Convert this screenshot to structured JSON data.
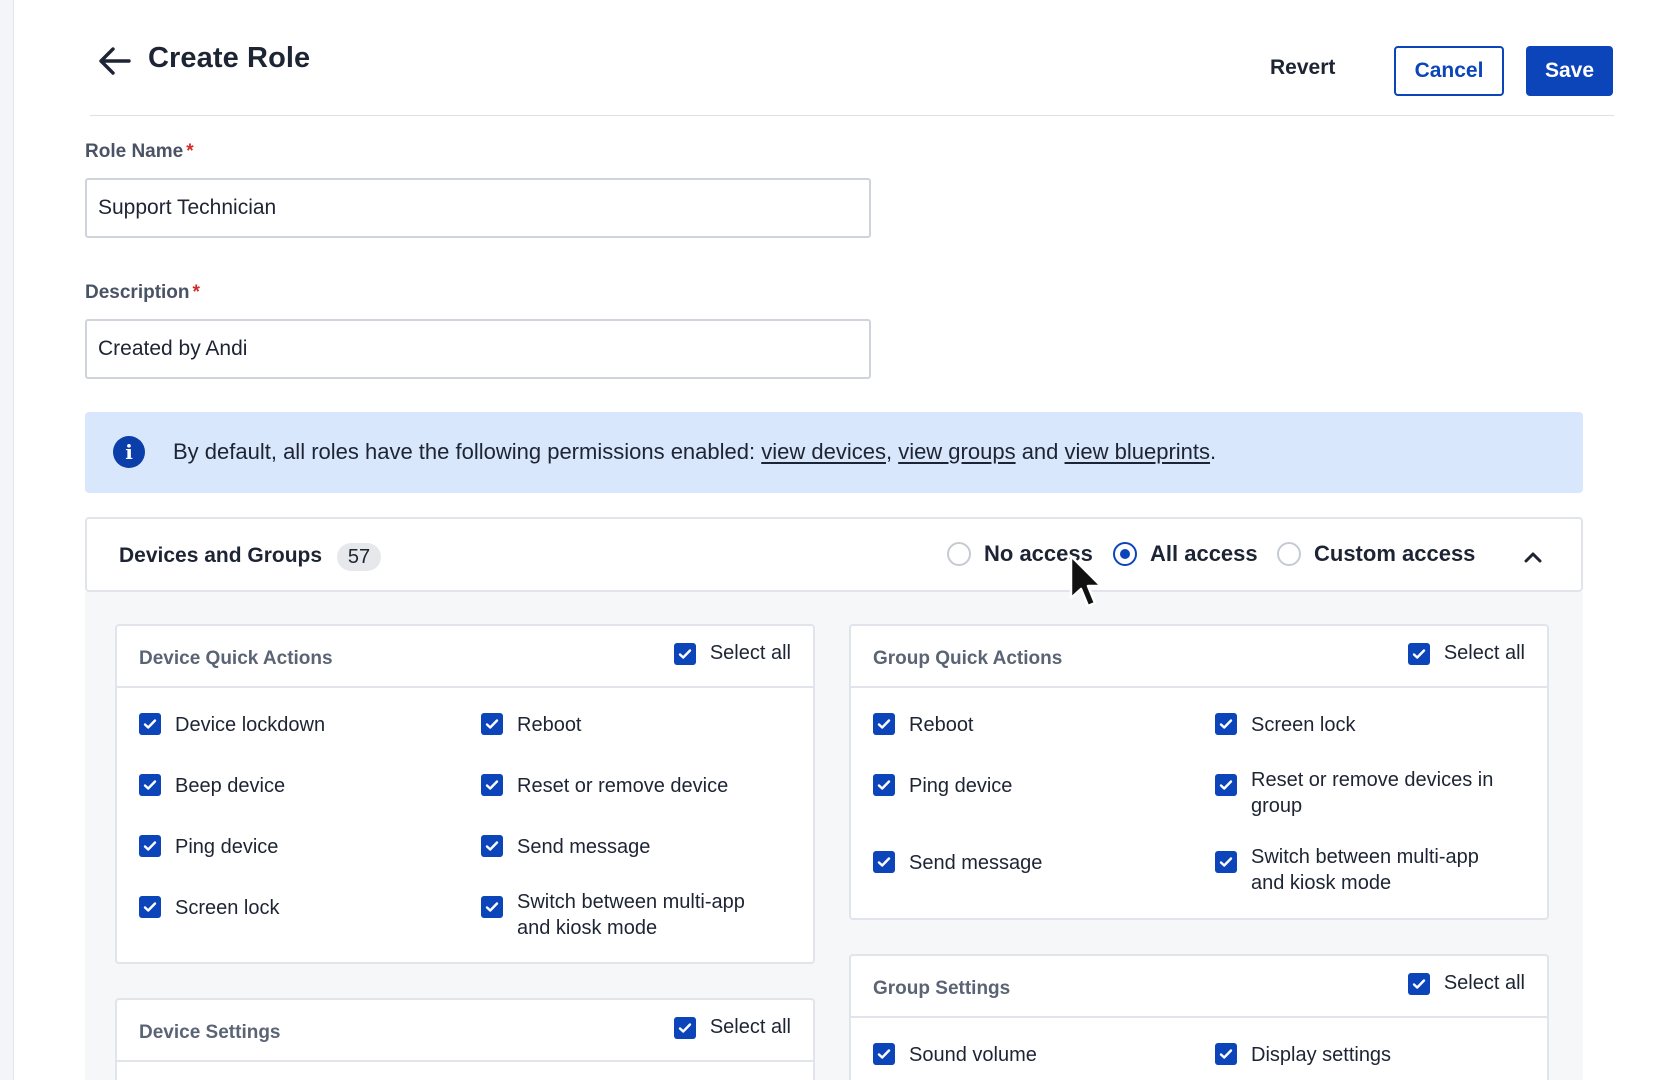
{
  "header": {
    "title": "Create Role",
    "revert_label": "Revert",
    "cancel_label": "Cancel",
    "save_label": "Save"
  },
  "form": {
    "role_name": {
      "label": "Role Name",
      "required_mark": "*",
      "value": "Support Technician"
    },
    "description": {
      "label": "Description",
      "required_mark": "*",
      "value": "Created by Andi"
    }
  },
  "info_banner": {
    "text_prefix": "By default, all roles have the following permissions enabled: ",
    "link1": "view devices",
    "sep1": ", ",
    "link2": "view groups",
    "sep2": " and ",
    "link3": "view blueprints",
    "suffix": "."
  },
  "section": {
    "title": "Devices and Groups",
    "count": "57",
    "access_options": [
      {
        "label": "No access",
        "selected": false
      },
      {
        "label": "All access",
        "selected": true
      },
      {
        "label": "Custom access",
        "selected": false
      }
    ]
  },
  "cards": {
    "device_quick_actions": {
      "title": "Device Quick Actions",
      "select_all": "Select all",
      "options": [
        "Device lockdown",
        "Reboot",
        "Beep device",
        "Reset or remove device",
        "Ping device",
        "Send message",
        "Screen lock",
        "Switch between multi-app and kiosk mode"
      ]
    },
    "group_quick_actions": {
      "title": "Group Quick Actions",
      "select_all": "Select all",
      "options": [
        "Reboot",
        "Screen lock",
        "Ping device",
        "Reset or remove devices in group",
        "Send message",
        "Switch between multi-app and kiosk mode"
      ]
    },
    "device_settings": {
      "title": "Device Settings",
      "select_all": "Select all"
    },
    "group_settings": {
      "title": "Group Settings",
      "select_all": "Select all",
      "options": [
        "Sound volume",
        "Display settings"
      ]
    }
  },
  "colors": {
    "primary": "#0b45b9",
    "banner_bg": "#d8e7fb",
    "required": "#d12c2c"
  }
}
